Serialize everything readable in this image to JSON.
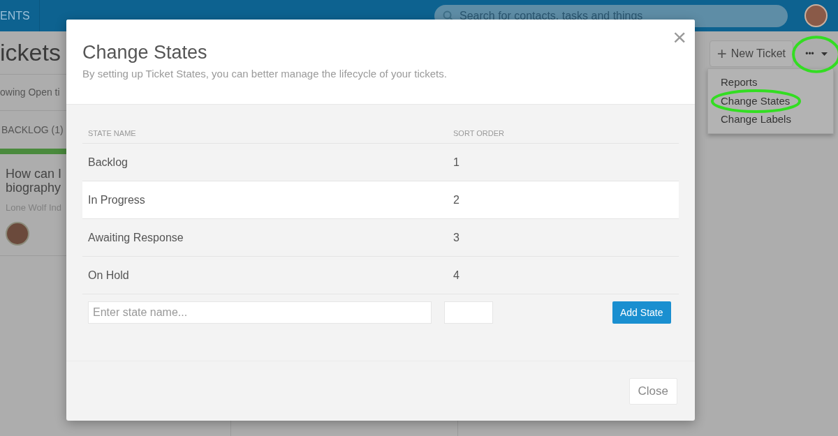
{
  "topbar": {
    "nav_item": "ENTS",
    "search": {
      "placeholder": "Search for contacts, tasks and things"
    }
  },
  "page": {
    "title": "ickets",
    "filter_text": "owing Open ti",
    "column": {
      "label": "BACKLOG (1)"
    },
    "tickets": [
      {
        "title_lines": [
          "How can I",
          "biography"
        ],
        "company": "Lone Wolf Ind"
      }
    ]
  },
  "toolbar": {
    "new_button": {
      "icon": "+",
      "label": "New Ticket"
    },
    "more_button": {
      "label": "•••",
      "circled": true
    },
    "menu": [
      {
        "label": "Reports",
        "circled": false
      },
      {
        "label": "Change States",
        "circled": true
      },
      {
        "label": "Change Labels",
        "circled": false
      }
    ]
  },
  "dialog": {
    "title": "Change States",
    "subtitle": "By setting up Ticket States, you can better manage the lifecycle of your tickets.",
    "close_icon": "×",
    "table": {
      "columns": [
        "STATE NAME",
        "SORT ORDER"
      ],
      "rows": [
        {
          "name": "Backlog",
          "order": "1",
          "highlighted": false
        },
        {
          "name": "In Progress",
          "order": "2",
          "highlighted": true
        },
        {
          "name": "Awaiting Response",
          "order": "3",
          "highlighted": false
        },
        {
          "name": "On Hold",
          "order": "4",
          "highlighted": false
        }
      ]
    },
    "new_state": {
      "name_placeholder": "Enter state name...",
      "add_button": "Add State"
    },
    "footer_button": "Close"
  }
}
